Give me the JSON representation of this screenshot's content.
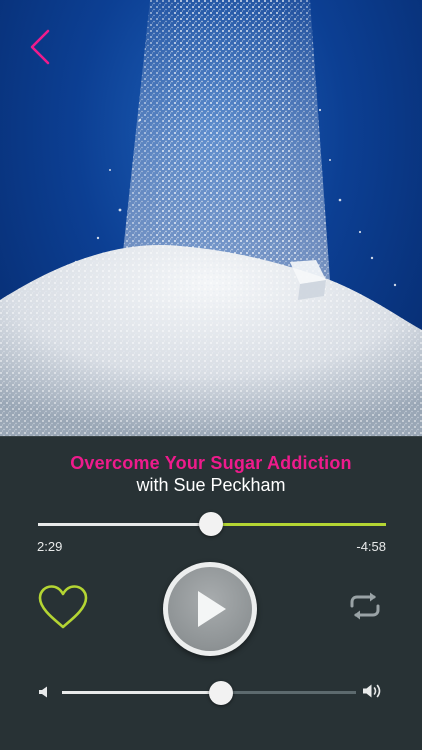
{
  "artwork": {
    "description_icon": "sugar-pile-image"
  },
  "nav": {
    "back_icon": "chevron-left-icon"
  },
  "track": {
    "title": "Overcome Your Sugar Addiction",
    "artist": "with Sue Peckham"
  },
  "progress": {
    "elapsed": "2:29",
    "remaining": "-4:58",
    "fraction": 0.497
  },
  "controls": {
    "favorite_icon": "heart-icon",
    "play_icon": "play-icon",
    "repeat_icon": "repeat-icon"
  },
  "volume": {
    "level": 0.54,
    "low_icon": "volume-low-icon",
    "high_icon": "volume-high-icon"
  },
  "colors": {
    "accent_title": "#ee1b8c",
    "accent_green": "#b4d533",
    "background": "#283235",
    "back_arrow": "#ee1b8c"
  }
}
